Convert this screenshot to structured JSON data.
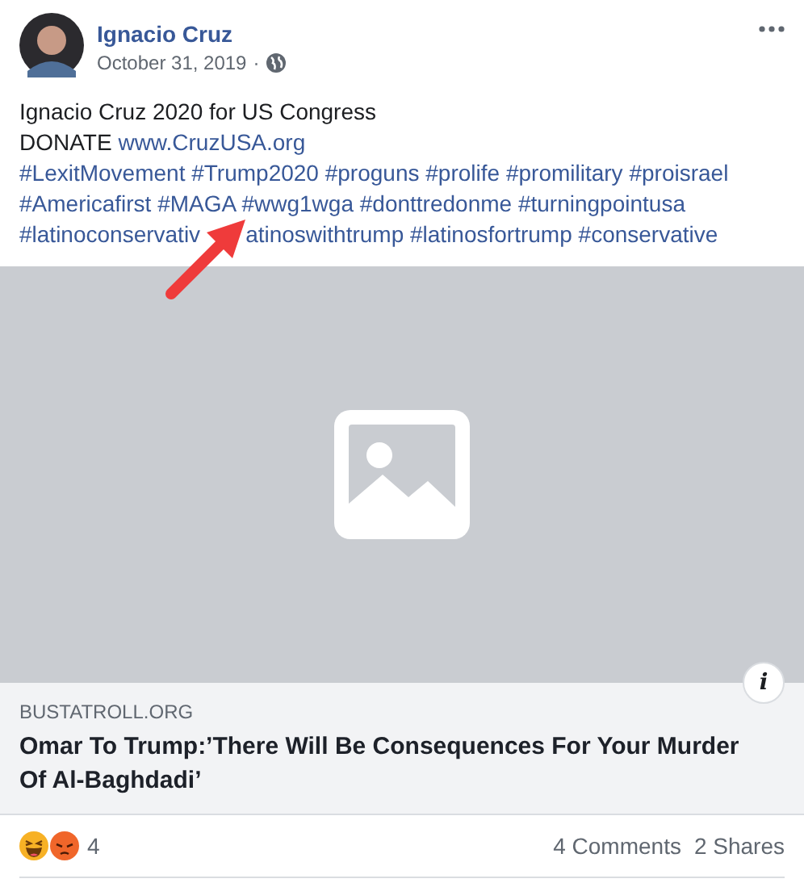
{
  "post": {
    "author": "Ignacio Cruz",
    "date": "October 31, 2019",
    "separator": "·",
    "title_line": "Ignacio Cruz 2020 for US Congress",
    "donate_label": "DONATE",
    "url": "www.CruzUSA.org",
    "hashtag_lines": [
      [
        {
          "kind": "hashtag",
          "text": "#LexitMovement"
        },
        {
          "kind": "hashtag",
          "text": "#Trump2020"
        },
        {
          "kind": "hashtag",
          "text": "#proguns"
        },
        {
          "kind": "hashtag",
          "text": "#prolife"
        },
        {
          "kind": "hashtag",
          "text": "#promilitary"
        },
        {
          "kind": "hashtag",
          "text": "#proisrael"
        }
      ],
      [
        {
          "kind": "hashtag",
          "text": "#Americafirst"
        },
        {
          "kind": "hashtag",
          "text": "#MAGA"
        },
        {
          "kind": "hashtag",
          "text": "#wwg1wga"
        },
        {
          "kind": "hashtag",
          "text": "#donttredonme"
        },
        {
          "kind": "hashtag",
          "text": "#turningpointusa"
        }
      ],
      [
        {
          "kind": "hashtag",
          "text": "#latinoconservativ"
        },
        {
          "kind": "covered"
        },
        {
          "kind": "hashtag",
          "text": "atinoswithtrump"
        },
        {
          "kind": "hashtag",
          "text": "#latinosfortrump"
        },
        {
          "kind": "hashtag",
          "text": "#conservative"
        }
      ]
    ]
  },
  "link_preview": {
    "kind": "picture",
    "domain": "BUSTATROLL.ORG",
    "headline": "Omar To Trump:’There Will Be Consequences For Your Murder Of Al-Baghdadi’",
    "info": "i"
  },
  "footer": {
    "reactions": [
      {
        "kind": "haha"
      },
      {
        "kind": "angry"
      }
    ],
    "reaction_count": "4",
    "comments": "4 Comments",
    "shares": "2 Shares"
  }
}
